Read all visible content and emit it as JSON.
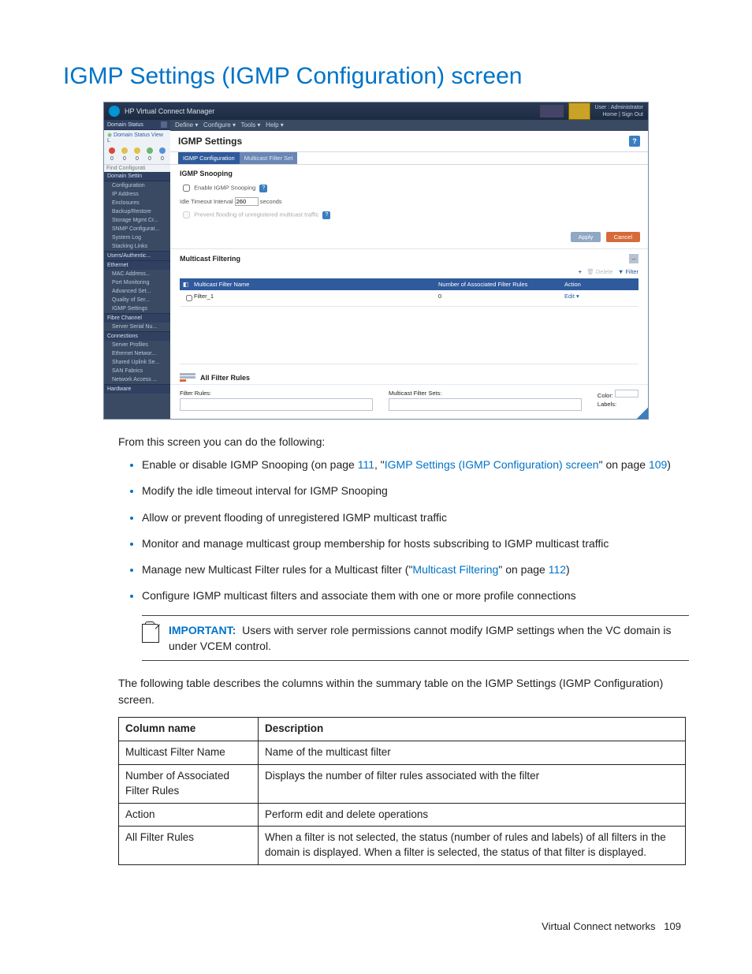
{
  "page_title": "IGMP Settings (IGMP Configuration) screen",
  "screenshot": {
    "app_title": "HP Virtual Connect Manager",
    "user_line1": "User : Administrator",
    "user_line2_home": "Home",
    "user_line2_signout": "Sign Out",
    "menu": [
      "Define ▾",
      "Configure ▾",
      "Tools ▾",
      "Help ▾"
    ],
    "side": {
      "domain_status": "Domain Status",
      "domain_status_view": "Domain Status   View L",
      "counts": [
        "0",
        "0",
        "0",
        "0",
        "0"
      ],
      "find": "Find Configurati",
      "domain_settings": "Domain Settin",
      "domain_items": [
        "Configuration",
        "IP Address",
        "Enclosures",
        "Backup/Restore",
        "Storage Mgmt Cr...",
        "SNMP Configurat...",
        "System Log",
        "Stacking Links"
      ],
      "users": "Users/Authentic...",
      "ethernet": "Ethernet",
      "eth_items": [
        "MAC Address...",
        "Port Monitoring",
        "Advanced Set...",
        "Quality of Ser...",
        "IGMP Settings"
      ],
      "fibre": "Fibre Channel",
      "fibre_items": [
        "Server Serial Nu..."
      ],
      "connections": "Connections",
      "conn_items": [
        "Server Profiles",
        "Ethernet Networ...",
        "Shared Uplink Se...",
        "SAN Fabrics",
        "Network Access ..."
      ],
      "hardware": "Hardware"
    },
    "content": {
      "title": "IGMP Settings",
      "tabs": [
        "IGMP Configuration",
        "Multicast Filter Set"
      ],
      "sec1_title": "IGMP Snooping",
      "enable_label": "Enable IGMP Snooping",
      "idle_label": "Idle Timeout Interval",
      "idle_value": "260",
      "idle_unit": "seconds",
      "flood_label": "Prevent flooding of unregistered multicast traffic",
      "btn_apply": "Apply",
      "btn_cancel": "Cancel",
      "sec2_title": "Multicast Filtering",
      "toolbar_plus": "+",
      "toolbar_delete": "Delete",
      "toolbar_filter": "Filter",
      "table_headers": [
        "",
        "Multicast Filter Name",
        "Number of Associated Filter Rules",
        "Action"
      ],
      "row1": {
        "name": "Filter_1",
        "count": "0",
        "action": "Edit ▾"
      },
      "all_rules": "All Filter Rules",
      "bottom": {
        "filter_rules": "Filter Rules:",
        "mfs": "Multicast Filter Sets:",
        "color": "Color:",
        "labels": "Labels:"
      }
    }
  },
  "intro": "From this screen you can do the following:",
  "bullets": [
    {
      "pre": "Enable or disable IGMP Snooping (on page ",
      "link1": "111",
      "mid": ", \"",
      "link2": "IGMP Settings (IGMP Configuration) screen",
      "post": "\" on page ",
      "link3": "109",
      "end": ")"
    },
    {
      "text": "Modify the idle timeout interval for IGMP Snooping"
    },
    {
      "text": "Allow or prevent flooding of unregistered IGMP multicast traffic"
    },
    {
      "text": "Monitor and manage multicast group membership for hosts subscribing to IGMP multicast traffic"
    },
    {
      "pre": "Manage new Multicast Filter rules for a Multicast filter (\"",
      "link1": "Multicast Filtering",
      "mid": "\" on page ",
      "link2": "112",
      "end": ")"
    },
    {
      "text": "Configure IGMP multicast filters and associate them with one or more profile connections"
    }
  ],
  "important": {
    "label": "IMPORTANT:",
    "text": "Users with server role permissions cannot modify IGMP settings when the VC domain is under VCEM control."
  },
  "lead": "The following table describes the columns within the summary table on the IGMP Settings (IGMP Configuration) screen.",
  "table": {
    "headers": [
      "Column name",
      "Description"
    ],
    "rows": [
      [
        "Multicast Filter Name",
        "Name of the multicast filter"
      ],
      [
        "Number of Associated Filter Rules",
        "Displays the number of filter rules associated with the filter"
      ],
      [
        "Action",
        "Perform edit and delete operations"
      ],
      [
        "All Filter Rules",
        "When a filter is not selected, the status (number of rules and labels) of all filters in the domain is displayed. When a filter is selected, the status of that filter is displayed."
      ]
    ]
  },
  "footer": {
    "section": "Virtual Connect networks",
    "page": "109"
  }
}
